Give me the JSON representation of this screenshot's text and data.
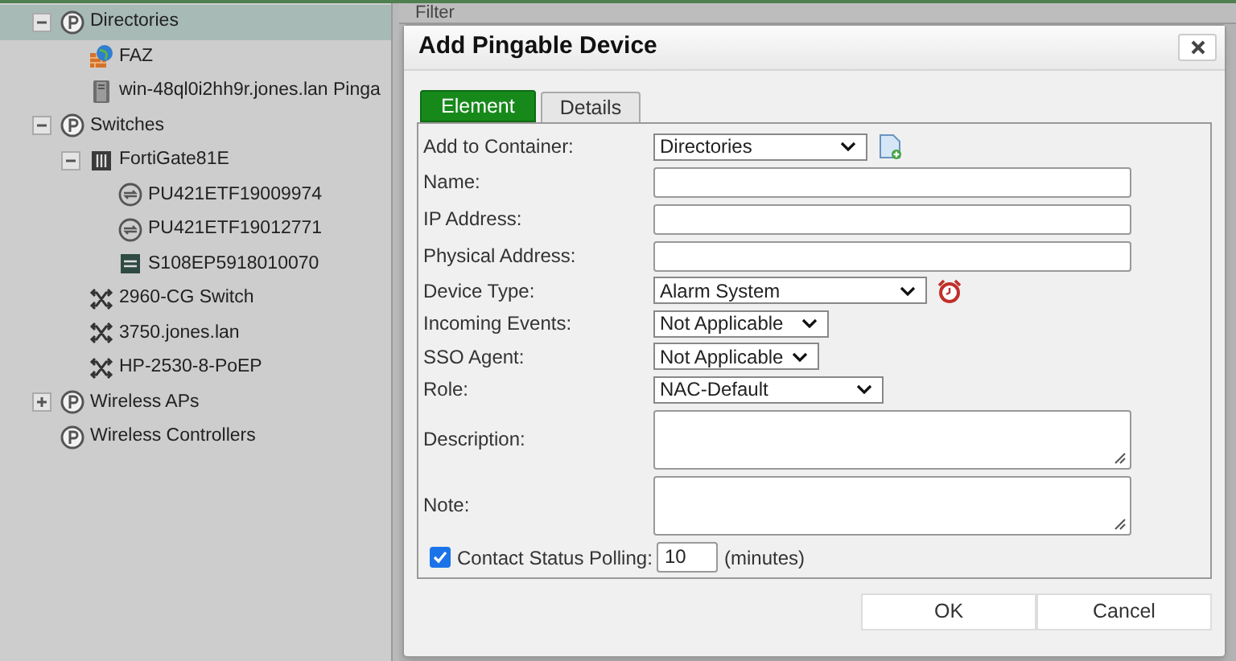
{
  "tree": [
    {
      "label": "Directories",
      "kind": "container",
      "expanded": true,
      "selected": true,
      "children": [
        {
          "label": "FAZ",
          "kind": "globe",
          "selected": false
        },
        {
          "label": "win-48ql0i2hh9r.jones.lan Pinga",
          "kind": "server",
          "selected": false
        }
      ]
    },
    {
      "label": "Switches",
      "kind": "container",
      "expanded": true,
      "selected": false,
      "children": [
        {
          "label": "FortiGate81E",
          "kind": "firewall",
          "expanded": true,
          "selected": false,
          "children": [
            {
              "label": "PU421ETF19009974",
              "kind": "access-point",
              "selected": false
            },
            {
              "label": "PU421ETF19012771",
              "kind": "access-point",
              "selected": false
            },
            {
              "label": "S108EP5918010070",
              "kind": "switch-box",
              "selected": false
            }
          ]
        },
        {
          "label": "2960-CG Switch",
          "kind": "switch",
          "selected": false
        },
        {
          "label": "3750.jones.lan",
          "kind": "switch",
          "selected": false
        },
        {
          "label": "HP-2530-8-PoEP",
          "kind": "switch",
          "selected": false
        }
      ]
    },
    {
      "label": "Wireless APs",
      "kind": "container",
      "expanded": false,
      "selected": false
    },
    {
      "label": "Wireless Controllers",
      "kind": "container",
      "selected": false
    }
  ],
  "background_panel": {
    "header": "Filter"
  },
  "dialog": {
    "title": "Add Pingable Device",
    "tabs": [
      {
        "label": "Element",
        "selected": true
      },
      {
        "label": "Details",
        "selected": false
      }
    ],
    "fields": [
      {
        "kind": "select",
        "label": "Add to Container:",
        "value": "Directories"
      },
      {
        "kind": "text",
        "label": "Name:"
      },
      {
        "kind": "text",
        "label": "IP Address:"
      },
      {
        "kind": "text",
        "label": "Physical Address:"
      },
      {
        "kind": "select",
        "label": "Device Type:",
        "value": "Alarm System"
      },
      {
        "kind": "select",
        "label": "Incoming Events:",
        "value": "Not Applicable"
      },
      {
        "kind": "select",
        "label": "SSO Agent:",
        "value": "Not Applicable"
      },
      {
        "kind": "select",
        "label": "Role:",
        "value": "NAC-Default"
      },
      {
        "kind": "textarea",
        "label": "Description:"
      },
      {
        "kind": "textarea",
        "label": "Note:"
      }
    ],
    "polling": {
      "label": "Contact Status Polling:",
      "checked": true,
      "value": "10",
      "unit": "(minutes)"
    },
    "buttons": [
      "OK",
      "Cancel"
    ]
  }
}
